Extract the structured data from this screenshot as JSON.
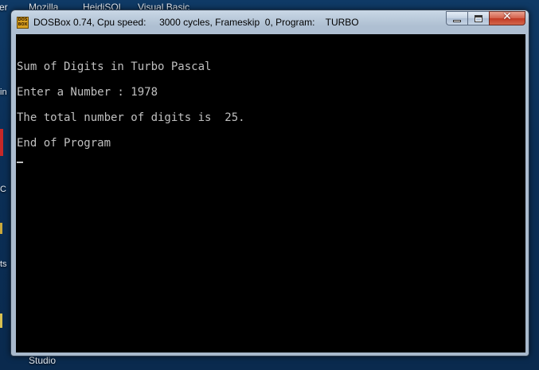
{
  "desktop": {
    "top_labels": [
      "er",
      "Mozilla",
      "HeidiSQL",
      "Visual Basic"
    ],
    "side_labels": [
      "in",
      "C",
      "ts"
    ],
    "bottom_label": "Studio"
  },
  "window": {
    "title": "DOSBox 0.74, Cpu speed:     3000 cycles, Frameskip  0, Program:    TURBO",
    "app_icon_text": "DOS BOX",
    "controls": {
      "minimize": "minimize",
      "maximize": "maximize",
      "close": "✕"
    }
  },
  "console": {
    "lines": [
      "Sum of Digits in Turbo Pascal",
      "Enter a Number : 1978",
      "The total number of digits is  25.",
      "End of Program"
    ]
  }
}
